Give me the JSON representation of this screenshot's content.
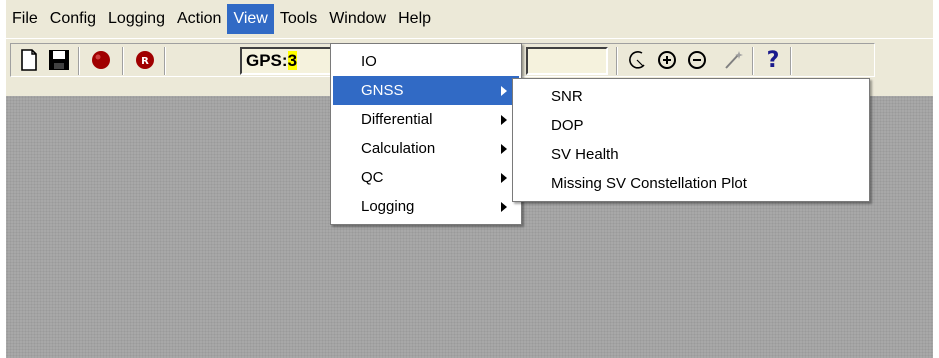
{
  "menubar": {
    "items": [
      {
        "label": "File"
      },
      {
        "label": "Config"
      },
      {
        "label": "Logging"
      },
      {
        "label": "Action"
      },
      {
        "label": "View"
      },
      {
        "label": "Tools"
      },
      {
        "label": "Window"
      },
      {
        "label": "Help"
      }
    ],
    "active": "View"
  },
  "toolbar": {
    "gps_label": "GPS:",
    "gps_value": "3",
    "record_badge": "R",
    "help_glyph": "?"
  },
  "view_menu": {
    "items": [
      {
        "label": "IO",
        "submenu": false
      },
      {
        "label": "GNSS",
        "submenu": true
      },
      {
        "label": "Differential",
        "submenu": true
      },
      {
        "label": "Calculation",
        "submenu": true
      },
      {
        "label": "QC",
        "submenu": true
      },
      {
        "label": "Logging",
        "submenu": true
      }
    ],
    "highlighted": "GNSS"
  },
  "gnss_menu": {
    "items": [
      {
        "label": "SNR"
      },
      {
        "label": "DOP"
      },
      {
        "label": "SV Health"
      },
      {
        "label": "Missing SV Constellation Plot"
      }
    ]
  },
  "colors": {
    "menu_highlight": "#316ac5",
    "chrome": "#ece9d8",
    "workspace": "#a8a8a8",
    "gps_value_bg": "#ffff00",
    "record_red": "#b00000"
  },
  "icons": [
    "new-file-icon",
    "save-disk-icon",
    "record-icon",
    "record-r-icon",
    "arc-icon",
    "zoom-in-icon",
    "zoom-out-icon",
    "wand-icon",
    "help-icon"
  ]
}
